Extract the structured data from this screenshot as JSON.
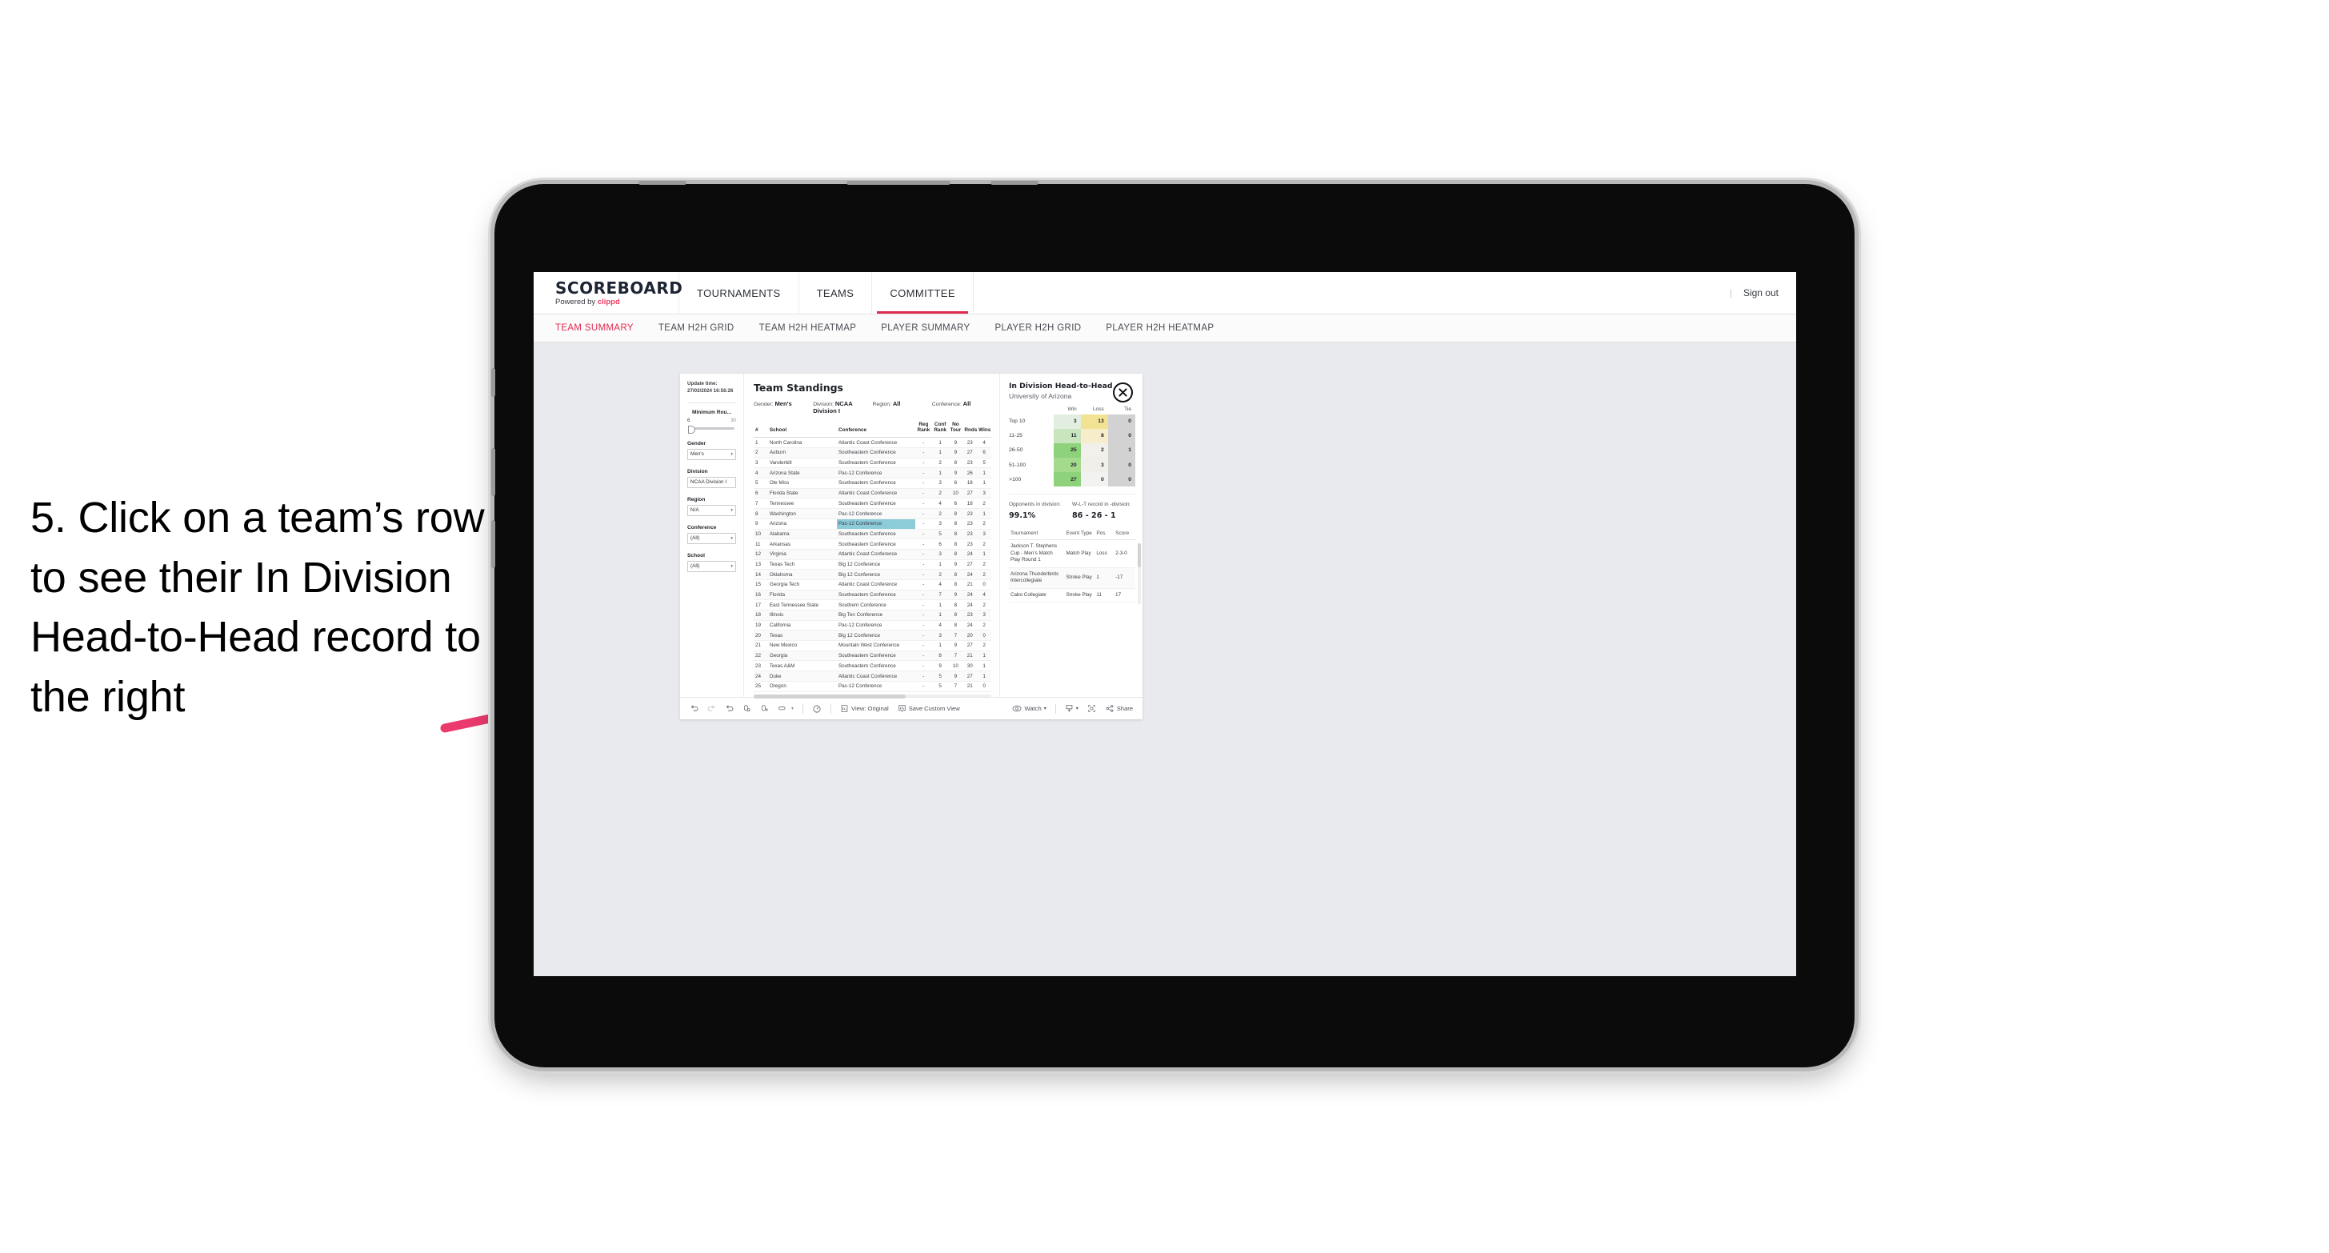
{
  "annotation": {
    "text": "5. Click on a team’s row to see their In Division Head-to-Head record to the right",
    "arrow_color": "#ea3a6e"
  },
  "appbar": {
    "brand_title": "SCOREBOARD",
    "brand_powered": "Powered by ",
    "brand_name": "clippd",
    "nav": [
      {
        "label": "TOURNAMENTS",
        "active": false
      },
      {
        "label": "TEAMS",
        "active": false
      },
      {
        "label": "COMMITTEE",
        "active": true
      }
    ],
    "divider": "|",
    "sign_out": "Sign out"
  },
  "tabs": [
    {
      "label": "TEAM SUMMARY",
      "active": true
    },
    {
      "label": "TEAM H2H GRID",
      "active": false
    },
    {
      "label": "TEAM H2H HEATMAP",
      "active": false
    },
    {
      "label": "PLAYER SUMMARY",
      "active": false
    },
    {
      "label": "PLAYER H2H GRID",
      "active": false
    },
    {
      "label": "PLAYER H2H HEATMAP",
      "active": false
    }
  ],
  "rail": {
    "update_label": "Update time:",
    "update_value": "27/03/2024 16:56:26",
    "slider": {
      "title": "Minimum Rou...",
      "min": "6",
      "max": "30"
    },
    "filters": [
      {
        "title": "Gender",
        "value": "Men's",
        "caret": "▾"
      },
      {
        "title": "Division",
        "value": "NCAA Division I",
        "caret": "▾"
      },
      {
        "title": "Region",
        "value": "N/A",
        "caret": "▾"
      },
      {
        "title": "Conference",
        "value": "(All)",
        "caret": "▾"
      },
      {
        "title": "School",
        "value": "(All)",
        "caret": "▾"
      }
    ]
  },
  "standings": {
    "title": "Team Standings",
    "filters": [
      {
        "key": "Gender: ",
        "value": "Men's"
      },
      {
        "key": "Division: ",
        "value": "NCAA Division I"
      },
      {
        "key": "Region: ",
        "value": "All"
      },
      {
        "key": "Conference: ",
        "value": "All"
      }
    ],
    "columns": [
      "#",
      "School",
      "Conference",
      "Reg Rank",
      "Conf Rank",
      "No Tour",
      "Rnds",
      "Wins"
    ],
    "rows": [
      {
        "n": "1",
        "school": "North Carolina",
        "conf": "Atlantic Coast Conference",
        "reg": "-",
        "crank": "1",
        "notour": "9",
        "rnds": "23",
        "wins": "4",
        "highlight": false
      },
      {
        "n": "2",
        "school": "Auburn",
        "conf": "Southeastern Conference",
        "reg": "-",
        "crank": "1",
        "notour": "9",
        "rnds": "27",
        "wins": "6",
        "highlight": false
      },
      {
        "n": "3",
        "school": "Vanderbilt",
        "conf": "Southeastern Conference",
        "reg": "-",
        "crank": "2",
        "notour": "8",
        "rnds": "23",
        "wins": "5",
        "highlight": false
      },
      {
        "n": "4",
        "school": "Arizona State",
        "conf": "Pac-12 Conference",
        "reg": "-",
        "crank": "1",
        "notour": "9",
        "rnds": "26",
        "wins": "1",
        "highlight": false
      },
      {
        "n": "5",
        "school": "Ole Miss",
        "conf": "Southeastern Conference",
        "reg": "-",
        "crank": "3",
        "notour": "6",
        "rnds": "18",
        "wins": "1",
        "highlight": false
      },
      {
        "n": "6",
        "school": "Florida State",
        "conf": "Atlantic Coast Conference",
        "reg": "-",
        "crank": "2",
        "notour": "10",
        "rnds": "27",
        "wins": "3",
        "highlight": false
      },
      {
        "n": "7",
        "school": "Tennessee",
        "conf": "Southeastern Conference",
        "reg": "-",
        "crank": "4",
        "notour": "6",
        "rnds": "18",
        "wins": "2",
        "highlight": false
      },
      {
        "n": "8",
        "school": "Washington",
        "conf": "Pac-12 Conference",
        "reg": "-",
        "crank": "2",
        "notour": "8",
        "rnds": "23",
        "wins": "1",
        "highlight": false
      },
      {
        "n": "9",
        "school": "Arizona",
        "conf": "Pac-12 Conference",
        "reg": "-",
        "crank": "3",
        "notour": "8",
        "rnds": "23",
        "wins": "2",
        "highlight": true
      },
      {
        "n": "10",
        "school": "Alabama",
        "conf": "Southeastern Conference",
        "reg": "-",
        "crank": "5",
        "notour": "8",
        "rnds": "23",
        "wins": "3",
        "highlight": false
      },
      {
        "n": "11",
        "school": "Arkansas",
        "conf": "Southeastern Conference",
        "reg": "-",
        "crank": "6",
        "notour": "8",
        "rnds": "23",
        "wins": "2",
        "highlight": false
      },
      {
        "n": "12",
        "school": "Virginia",
        "conf": "Atlantic Coast Conference",
        "reg": "-",
        "crank": "3",
        "notour": "8",
        "rnds": "24",
        "wins": "1",
        "highlight": false
      },
      {
        "n": "13",
        "school": "Texas Tech",
        "conf": "Big 12 Conference",
        "reg": "-",
        "crank": "1",
        "notour": "9",
        "rnds": "27",
        "wins": "2",
        "highlight": false
      },
      {
        "n": "14",
        "school": "Oklahoma",
        "conf": "Big 12 Conference",
        "reg": "-",
        "crank": "2",
        "notour": "8",
        "rnds": "24",
        "wins": "2",
        "highlight": false
      },
      {
        "n": "15",
        "school": "Georgia Tech",
        "conf": "Atlantic Coast Conference",
        "reg": "-",
        "crank": "4",
        "notour": "8",
        "rnds": "21",
        "wins": "0",
        "highlight": false
      },
      {
        "n": "16",
        "school": "Florida",
        "conf": "Southeastern Conference",
        "reg": "-",
        "crank": "7",
        "notour": "9",
        "rnds": "24",
        "wins": "4",
        "highlight": false
      },
      {
        "n": "17",
        "school": "East Tennessee State",
        "conf": "Southern Conference",
        "reg": "-",
        "crank": "1",
        "notour": "8",
        "rnds": "24",
        "wins": "2",
        "highlight": false
      },
      {
        "n": "18",
        "school": "Illinois",
        "conf": "Big Ten Conference",
        "reg": "-",
        "crank": "1",
        "notour": "8",
        "rnds": "23",
        "wins": "3",
        "highlight": false
      },
      {
        "n": "19",
        "school": "California",
        "conf": "Pac-12 Conference",
        "reg": "-",
        "crank": "4",
        "notour": "8",
        "rnds": "24",
        "wins": "2",
        "highlight": false
      },
      {
        "n": "20",
        "school": "Texas",
        "conf": "Big 12 Conference",
        "reg": "-",
        "crank": "3",
        "notour": "7",
        "rnds": "20",
        "wins": "0",
        "highlight": false
      },
      {
        "n": "21",
        "school": "New Mexico",
        "conf": "Mountain West Conference",
        "reg": "-",
        "crank": "1",
        "notour": "9",
        "rnds": "27",
        "wins": "2",
        "highlight": false
      },
      {
        "n": "22",
        "school": "Georgia",
        "conf": "Southeastern Conference",
        "reg": "-",
        "crank": "8",
        "notour": "7",
        "rnds": "21",
        "wins": "1",
        "highlight": false
      },
      {
        "n": "23",
        "school": "Texas A&M",
        "conf": "Southeastern Conference",
        "reg": "-",
        "crank": "9",
        "notour": "10",
        "rnds": "30",
        "wins": "1",
        "highlight": false
      },
      {
        "n": "24",
        "school": "Duke",
        "conf": "Atlantic Coast Conference",
        "reg": "-",
        "crank": "5",
        "notour": "9",
        "rnds": "27",
        "wins": "1",
        "highlight": false
      },
      {
        "n": "25",
        "school": "Oregon",
        "conf": "Pac-12 Conference",
        "reg": "-",
        "crank": "5",
        "notour": "7",
        "rnds": "21",
        "wins": "0",
        "highlight": false
      }
    ]
  },
  "detail": {
    "title": "In Division Head-to-Head",
    "subtitle": "University of Arizona",
    "close_icon": "close-icon",
    "h2h": {
      "columns": [
        "",
        "Win",
        "Loss",
        "Tie"
      ],
      "rows": [
        {
          "label": "Top 10",
          "win": "3",
          "loss": "13",
          "tie": "0",
          "win_color": "#e2efe0",
          "loss_color": "#f2e294",
          "tie_color": "#d2d2d2"
        },
        {
          "label": "11-25",
          "win": "11",
          "loss": "8",
          "tie": "0",
          "win_color": "#c9e5be",
          "loss_color": "#f7edcb",
          "tie_color": "#d2d2d2"
        },
        {
          "label": "26-50",
          "win": "25",
          "loss": "2",
          "tie": "1",
          "win_color": "#8ed27c",
          "loss_color": "#f2f0eb",
          "tie_color": "#d2d2d2"
        },
        {
          "label": "51-100",
          "win": "20",
          "loss": "3",
          "tie": "0",
          "win_color": "#a4da8c",
          "loss_color": "#f1efe9",
          "tie_color": "#d2d2d2"
        },
        {
          "label": ">100",
          "win": "27",
          "loss": "0",
          "tie": "0",
          "win_color": "#8ed27c",
          "loss_color": "#f2f2f0",
          "tie_color": "#d2d2d2"
        }
      ]
    },
    "stats": [
      {
        "key": "Opponents in division:",
        "value": "99.1%"
      },
      {
        "key": "W-L-T record in -division:",
        "value": "86 - 26 - 1"
      }
    ],
    "tournaments": {
      "columns": [
        "Tournament",
        "Event Type",
        "Pos",
        "Score"
      ],
      "rows": [
        {
          "name": "Jackson T. Stephens Cup - Men’s Match Play Round 1",
          "type": "Match Play",
          "pos": "Loss",
          "score": "2-3-0"
        },
        {
          "name": "Arizona Thunderbirds Intercollegiate",
          "type": "Stroke Play",
          "pos": "1",
          "score": "-17"
        },
        {
          "name": "Cabo Collegiate",
          "type": "Stroke Play",
          "pos": "11",
          "score": "17"
        }
      ]
    }
  },
  "toolbar": {
    "view_label": "View: Original",
    "save_label": "Save Custom View",
    "watch_label": "Watch",
    "share_label": "Share",
    "caret": "▾"
  }
}
